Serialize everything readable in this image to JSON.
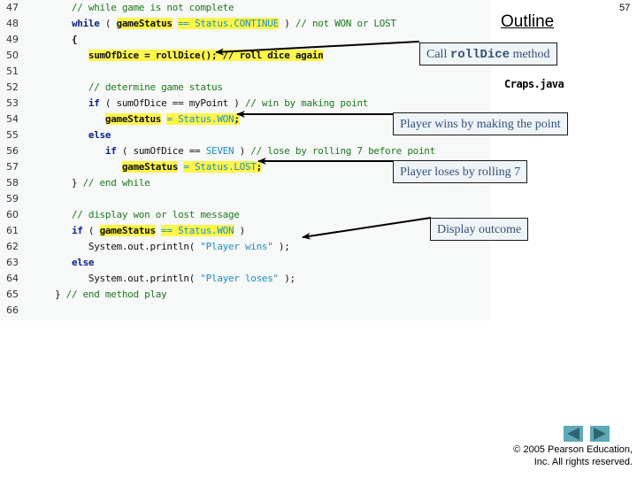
{
  "slide": {
    "outline_title": "Outline",
    "page_number": "57",
    "file_name": "Craps.java",
    "copyright_line1": "© 2005 Pearson Education,",
    "copyright_line2": "Inc.  All rights reserved."
  },
  "navigation": {
    "prev_icon": "triangle-left",
    "next_icon": "triangle-right",
    "color": "#5ea8b8"
  },
  "colors": {
    "highlight": "#fff64a",
    "comment": "#1b7a1b",
    "keyword": "#0a1f8c",
    "constant": "#1a8fbf",
    "callout_bg": "#eef4f8",
    "callout_text": "#34507a",
    "code_bg": "#f7f8f8"
  },
  "code": {
    "lines": [
      {
        "num": "47",
        "tokens": [
          {
            "t": "      // while game is not complete",
            "c": "comment"
          }
        ]
      },
      {
        "num": "48",
        "tokens": [
          {
            "t": "      ",
            "c": "plain"
          },
          {
            "t": "while",
            "c": "kw"
          },
          {
            "t": " ( ",
            "c": "plain"
          },
          {
            "t": "gameStatus",
            "c": "bold",
            "hl": true
          },
          {
            "t": " == ",
            "c": "const",
            "hl": true
          },
          {
            "t": "Status.CONTINUE",
            "c": "const",
            "hl": true
          },
          {
            "t": " ) ",
            "c": "plain"
          },
          {
            "t": "// not WON or LOST",
            "c": "comment"
          }
        ]
      },
      {
        "num": "49",
        "tokens": [
          {
            "t": "      {",
            "c": "bold"
          }
        ]
      },
      {
        "num": "50",
        "tokens": [
          {
            "t": "         ",
            "c": "plain"
          },
          {
            "t": "sumOfDice = rollDice(); // roll dice again",
            "c": "bold",
            "hl": true
          }
        ]
      },
      {
        "num": "51",
        "tokens": []
      },
      {
        "num": "52",
        "tokens": [
          {
            "t": "         // determine game status",
            "c": "comment"
          }
        ]
      },
      {
        "num": "53",
        "tokens": [
          {
            "t": "         ",
            "c": "plain"
          },
          {
            "t": "if",
            "c": "kw"
          },
          {
            "t": " ( sumOfDice == myPoint ) ",
            "c": "plain"
          },
          {
            "t": "// win by making point",
            "c": "comment"
          }
        ]
      },
      {
        "num": "54",
        "tokens": [
          {
            "t": "            ",
            "c": "plain"
          },
          {
            "t": "gameStatus",
            "c": "bold",
            "hl": true
          },
          {
            "t": " = ",
            "c": "const",
            "hl": true
          },
          {
            "t": "Status.WON",
            "c": "const",
            "hl": true
          },
          {
            "t": ";",
            "c": "bold",
            "hl": true
          }
        ]
      },
      {
        "num": "55",
        "tokens": [
          {
            "t": "         ",
            "c": "plain"
          },
          {
            "t": "else",
            "c": "kw"
          }
        ]
      },
      {
        "num": "56",
        "tokens": [
          {
            "t": "            ",
            "c": "plain"
          },
          {
            "t": "if",
            "c": "kw"
          },
          {
            "t": " ( sumOfDice == ",
            "c": "plain"
          },
          {
            "t": "SEVEN",
            "c": "const"
          },
          {
            "t": " ) ",
            "c": "plain"
          },
          {
            "t": "// lose by rolling 7 before point",
            "c": "comment"
          }
        ]
      },
      {
        "num": "57",
        "tokens": [
          {
            "t": "               ",
            "c": "plain"
          },
          {
            "t": "gameStatus",
            "c": "bold",
            "hl": true
          },
          {
            "t": " = ",
            "c": "const",
            "hl": true
          },
          {
            "t": "Status.LOST",
            "c": "const",
            "hl": true
          },
          {
            "t": ";",
            "c": "bold",
            "hl": true
          }
        ]
      },
      {
        "num": "58",
        "tokens": [
          {
            "t": "      } ",
            "c": "plain"
          },
          {
            "t": "// end while",
            "c": "comment"
          }
        ]
      },
      {
        "num": "59",
        "tokens": []
      },
      {
        "num": "60",
        "tokens": [
          {
            "t": "      // display won or lost message",
            "c": "comment"
          }
        ]
      },
      {
        "num": "61",
        "tokens": [
          {
            "t": "      ",
            "c": "plain"
          },
          {
            "t": "if",
            "c": "kw"
          },
          {
            "t": " ( ",
            "c": "plain"
          },
          {
            "t": "gameStatus",
            "c": "bold",
            "hl": true
          },
          {
            "t": " == ",
            "c": "const",
            "hl": true
          },
          {
            "t": "Status.WON",
            "c": "const",
            "hl": true
          },
          {
            "t": " )",
            "c": "plain"
          }
        ]
      },
      {
        "num": "62",
        "tokens": [
          {
            "t": "         System.out.println( ",
            "c": "plain"
          },
          {
            "t": "\"Player wins\"",
            "c": "str"
          },
          {
            "t": " );",
            "c": "plain"
          }
        ]
      },
      {
        "num": "63",
        "tokens": [
          {
            "t": "      ",
            "c": "plain"
          },
          {
            "t": "else",
            "c": "kw"
          }
        ]
      },
      {
        "num": "64",
        "tokens": [
          {
            "t": "         System.out.println( ",
            "c": "plain"
          },
          {
            "t": "\"Player loses\"",
            "c": "str"
          },
          {
            "t": " );",
            "c": "plain"
          }
        ]
      },
      {
        "num": "65",
        "tokens": [
          {
            "t": "   } ",
            "c": "plain"
          },
          {
            "t": "// end method play",
            "c": "comment"
          }
        ]
      },
      {
        "num": "66",
        "tokens": []
      }
    ]
  },
  "callouts": {
    "roll_dice": {
      "prefix": "Call ",
      "code": "rollDice",
      "suffix": " method"
    },
    "player_wins": "Player wins by making the point",
    "player_loses": "Player loses by rolling 7",
    "display_outcome": "Display outcome"
  }
}
